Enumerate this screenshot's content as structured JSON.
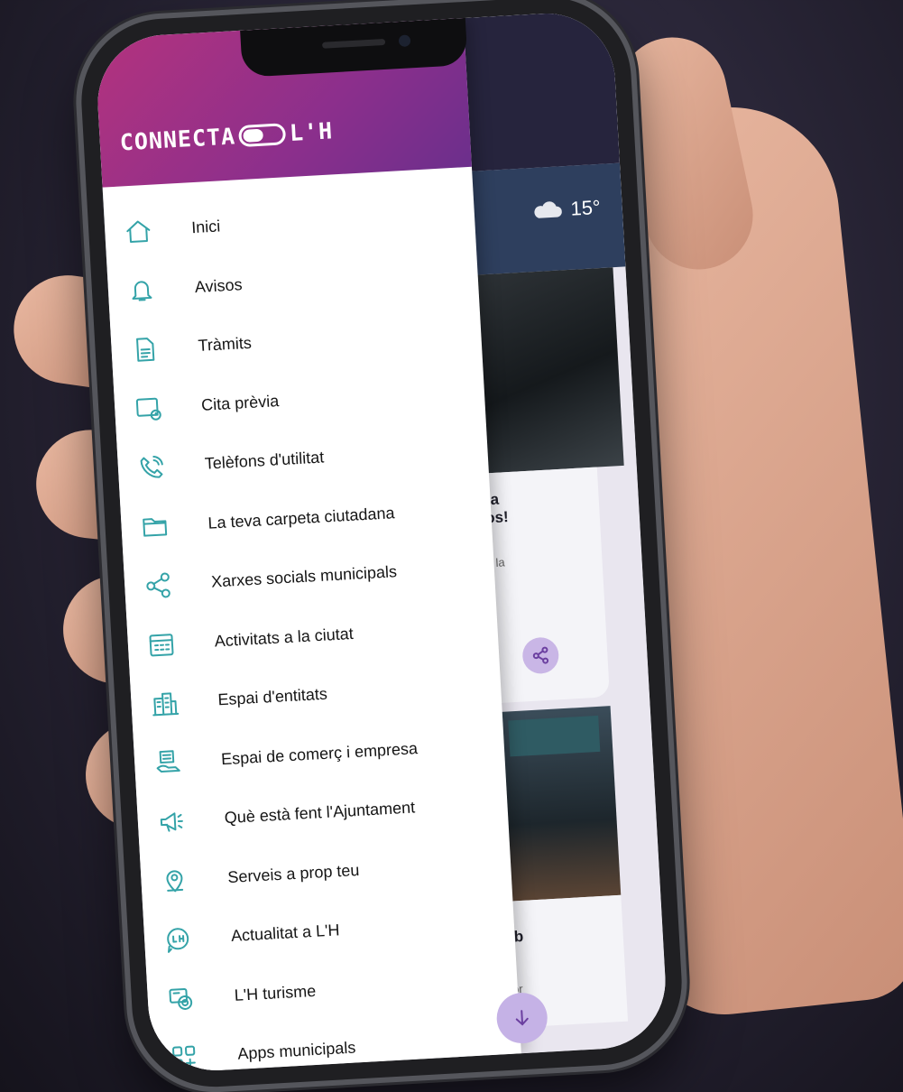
{
  "app": {
    "logo_left": "CONNECTA",
    "logo_right": "L'H"
  },
  "weather": {
    "icon": "cloud-icon",
    "temperature": "15°"
  },
  "menu": [
    {
      "label": "Inici",
      "icon": "home-icon"
    },
    {
      "label": "Avisos",
      "icon": "bell-icon"
    },
    {
      "label": "Tràmits",
      "icon": "document-icon"
    },
    {
      "label": "Cita prèvia",
      "icon": "calendar-clock-icon"
    },
    {
      "label": "Telèfons d'utilitat",
      "icon": "phone-icon"
    },
    {
      "label": "La teva carpeta ciutadana",
      "icon": "folder-icon"
    },
    {
      "label": "Xarxes socials municipals",
      "icon": "share-icon"
    },
    {
      "label": "Activitats a la ciutat",
      "icon": "calendar-icon"
    },
    {
      "label": "Espai d'entitats",
      "icon": "buildings-icon"
    },
    {
      "label": "Espai de comerç i empresa",
      "icon": "shop-icon"
    },
    {
      "label": "Què està fent l'Ajuntament",
      "icon": "megaphone-icon"
    },
    {
      "label": "Serveis a prop teu",
      "icon": "location-pin-icon"
    },
    {
      "label": "Actualitat a L'H",
      "icon": "news-bubble-icon"
    },
    {
      "label": "L'H turisme",
      "icon": "tourism-icon"
    },
    {
      "label": "Apps municipals",
      "icon": "apps-grid-icon"
    }
  ],
  "background_cards": {
    "card1_title": "uta\nllos!",
    "card1_subtitle": "de la",
    "card2_title": "mb",
    "card2_subtitle": "nior"
  },
  "colors": {
    "header_gradient_start": "#b3337e",
    "header_gradient_end": "#6c2f8c",
    "icon_teal": "#34a3a8",
    "fab": "#c5b2e6"
  }
}
